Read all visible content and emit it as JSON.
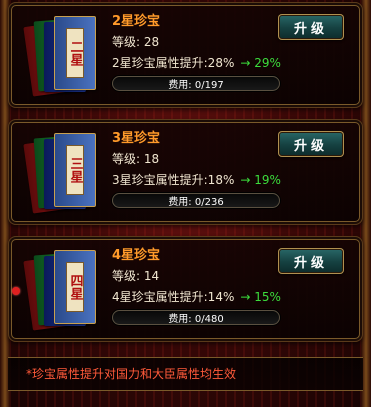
{
  "treasures": [
    {
      "title": "2星珍宝",
      "book_label": "二星",
      "level_label": "等级:",
      "level": "28",
      "attr_text": "2星珍宝属性提升:28%",
      "attr_next": "→ 29%",
      "cost": "费用: 0/197",
      "button": "升级"
    },
    {
      "title": "3星珍宝",
      "book_label": "三星",
      "level_label": "等级:",
      "level": "18",
      "attr_text": "3星珍宝属性提升:18%",
      "attr_next": "→ 19%",
      "cost": "费用: 0/236",
      "button": "升级"
    },
    {
      "title": "4星珍宝",
      "book_label": "四星",
      "level_label": "等级:",
      "level": "14",
      "attr_text": "4星珍宝属性提升:14%",
      "attr_next": "→ 15%",
      "cost": "费用: 0/480",
      "button": "升级"
    }
  ],
  "footer": {
    "note": "*珍宝属性提升对国力和大臣属性均生效"
  },
  "colors": {
    "title": "#ff9a2a",
    "next_value": "#3cdc3c",
    "footer_note": "#ff5a3a",
    "button": "#154040"
  },
  "icons": {
    "treasure": "book-stack-icon",
    "notification": "red-dot-icon"
  }
}
